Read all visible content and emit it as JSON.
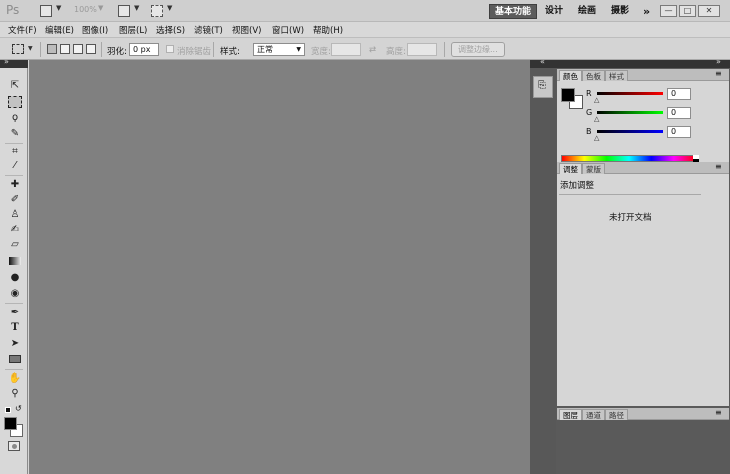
{
  "titlebar": {
    "logo": "Ps",
    "zoom": "100%",
    "workspaces": [
      "基本功能",
      "设计",
      "绘画",
      "摄影"
    ],
    "more": "»",
    "window_buttons": [
      "—",
      "□",
      "✕"
    ]
  },
  "menubar": {
    "items": [
      "文件(F)",
      "编辑(E)",
      "图像(I)",
      "图层(L)",
      "选择(S)",
      "滤镜(T)",
      "视图(V)",
      "窗口(W)",
      "帮助(H)"
    ]
  },
  "options": {
    "feather_label": "羽化:",
    "feather_value": "0 px",
    "antialias_label": "消除锯齿",
    "style_label": "样式:",
    "style_value": "正常",
    "width_label": "宽度:",
    "height_label": "高度:",
    "refine_edge": "调整边缘..."
  },
  "tools": [
    "move-tool",
    "marquee-tool",
    "lasso-tool",
    "quick-select-tool",
    "crop-tool",
    "eyedropper-tool",
    "healing-tool",
    "brush-tool",
    "stamp-tool",
    "history-brush-tool",
    "eraser-tool",
    "gradient-tool",
    "blur-tool",
    "dodge-tool",
    "pen-tool",
    "type-tool",
    "path-select-tool",
    "shape-tool",
    "hand-tool",
    "zoom-tool"
  ],
  "type_tool_glyph": "T",
  "color_panel": {
    "tabs": [
      "颜色",
      "色板",
      "样式"
    ],
    "channels": [
      {
        "label": "R",
        "value": "0",
        "color": "#d01010"
      },
      {
        "label": "G",
        "value": "0",
        "color": "#10c010"
      },
      {
        "label": "B",
        "value": "0",
        "color": "#1010d0"
      }
    ],
    "foreground": "#000000",
    "background": "#ffffff"
  },
  "adjust_panel": {
    "tabs": [
      "调整",
      "蒙版"
    ],
    "title": "添加调整",
    "message": "未打开文档"
  },
  "layers_panel": {
    "tabs": [
      "图层",
      "通道",
      "路径"
    ]
  }
}
